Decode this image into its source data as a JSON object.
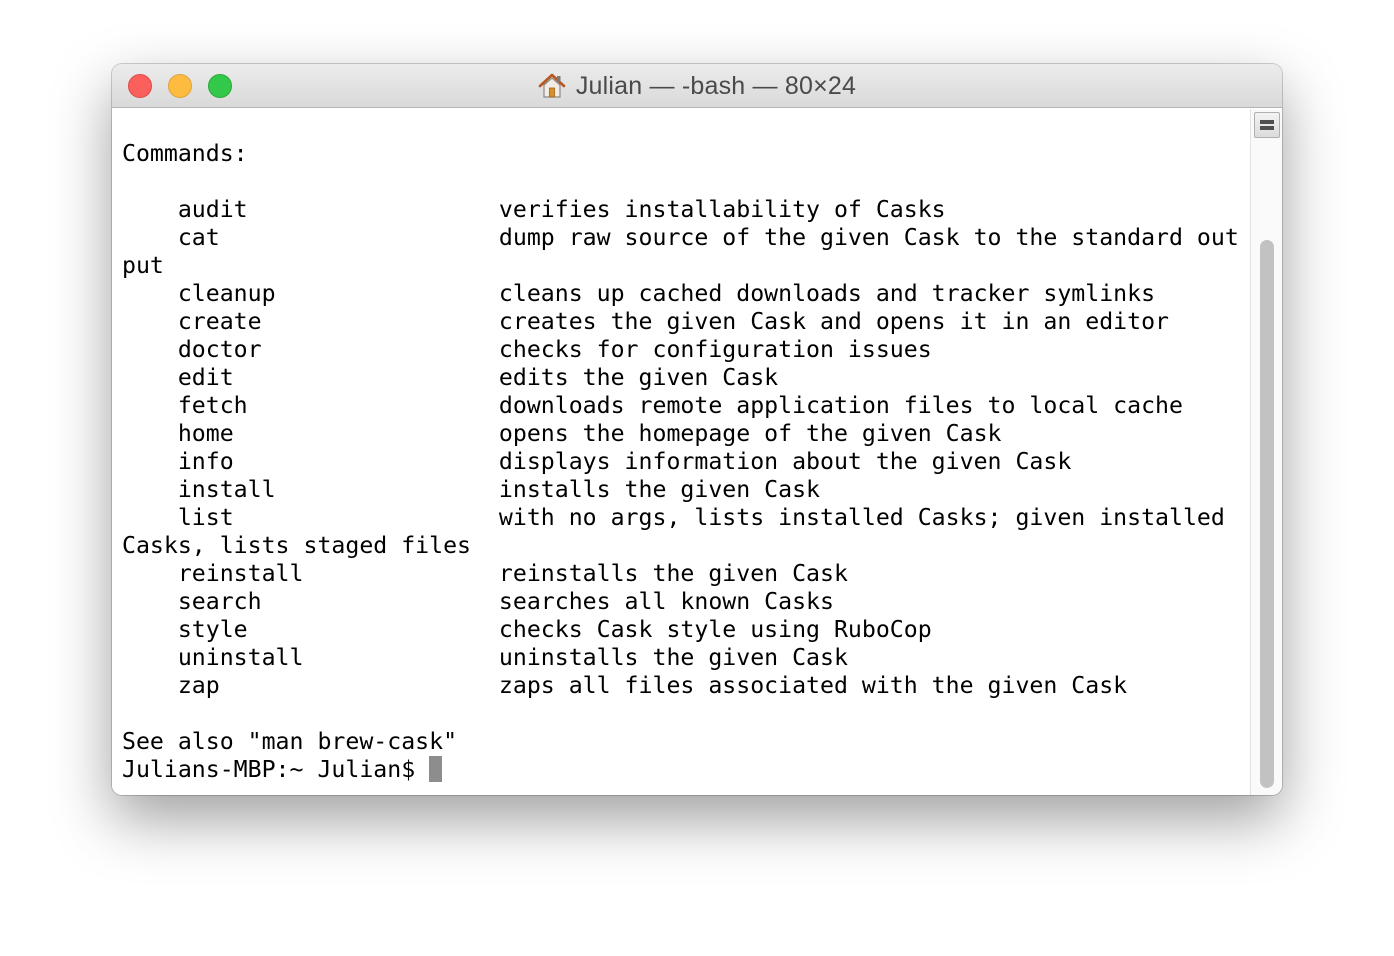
{
  "window": {
    "title": "Julian — -bash — 80×24"
  },
  "terminal": {
    "lines": [
      "Commands:",
      "",
      "    audit                  verifies installability of Casks",
      "    cat                    dump raw source of the given Cask to the standard out",
      "put",
      "    cleanup                cleans up cached downloads and tracker symlinks",
      "    create                 creates the given Cask and opens it in an editor",
      "    doctor                 checks for configuration issues",
      "    edit                   edits the given Cask",
      "    fetch                  downloads remote application files to local cache",
      "    home                   opens the homepage of the given Cask",
      "    info                   displays information about the given Cask",
      "    install                installs the given Cask",
      "    list                   with no args, lists installed Casks; given installed",
      "Casks, lists staged files",
      "    reinstall              reinstalls the given Cask",
      "    search                 searches all known Casks",
      "    style                  checks Cask style using RuboCop",
      "    uninstall              uninstalls the given Cask",
      "    zap                    zaps all files associated with the given Cask",
      "",
      "See also \"man brew-cask\""
    ],
    "prompt": "Julians-MBP:~ Julian$ "
  },
  "icons": {
    "title_icon": "home-icon",
    "close": "close-button",
    "minimize": "minimize-button",
    "zoom": "zoom-button",
    "split": "split-pane-icon"
  },
  "colors": {
    "close": "#fc605c",
    "minimize": "#fdbc40",
    "zoom": "#34c84a",
    "cursor": "#8d8d8d"
  }
}
